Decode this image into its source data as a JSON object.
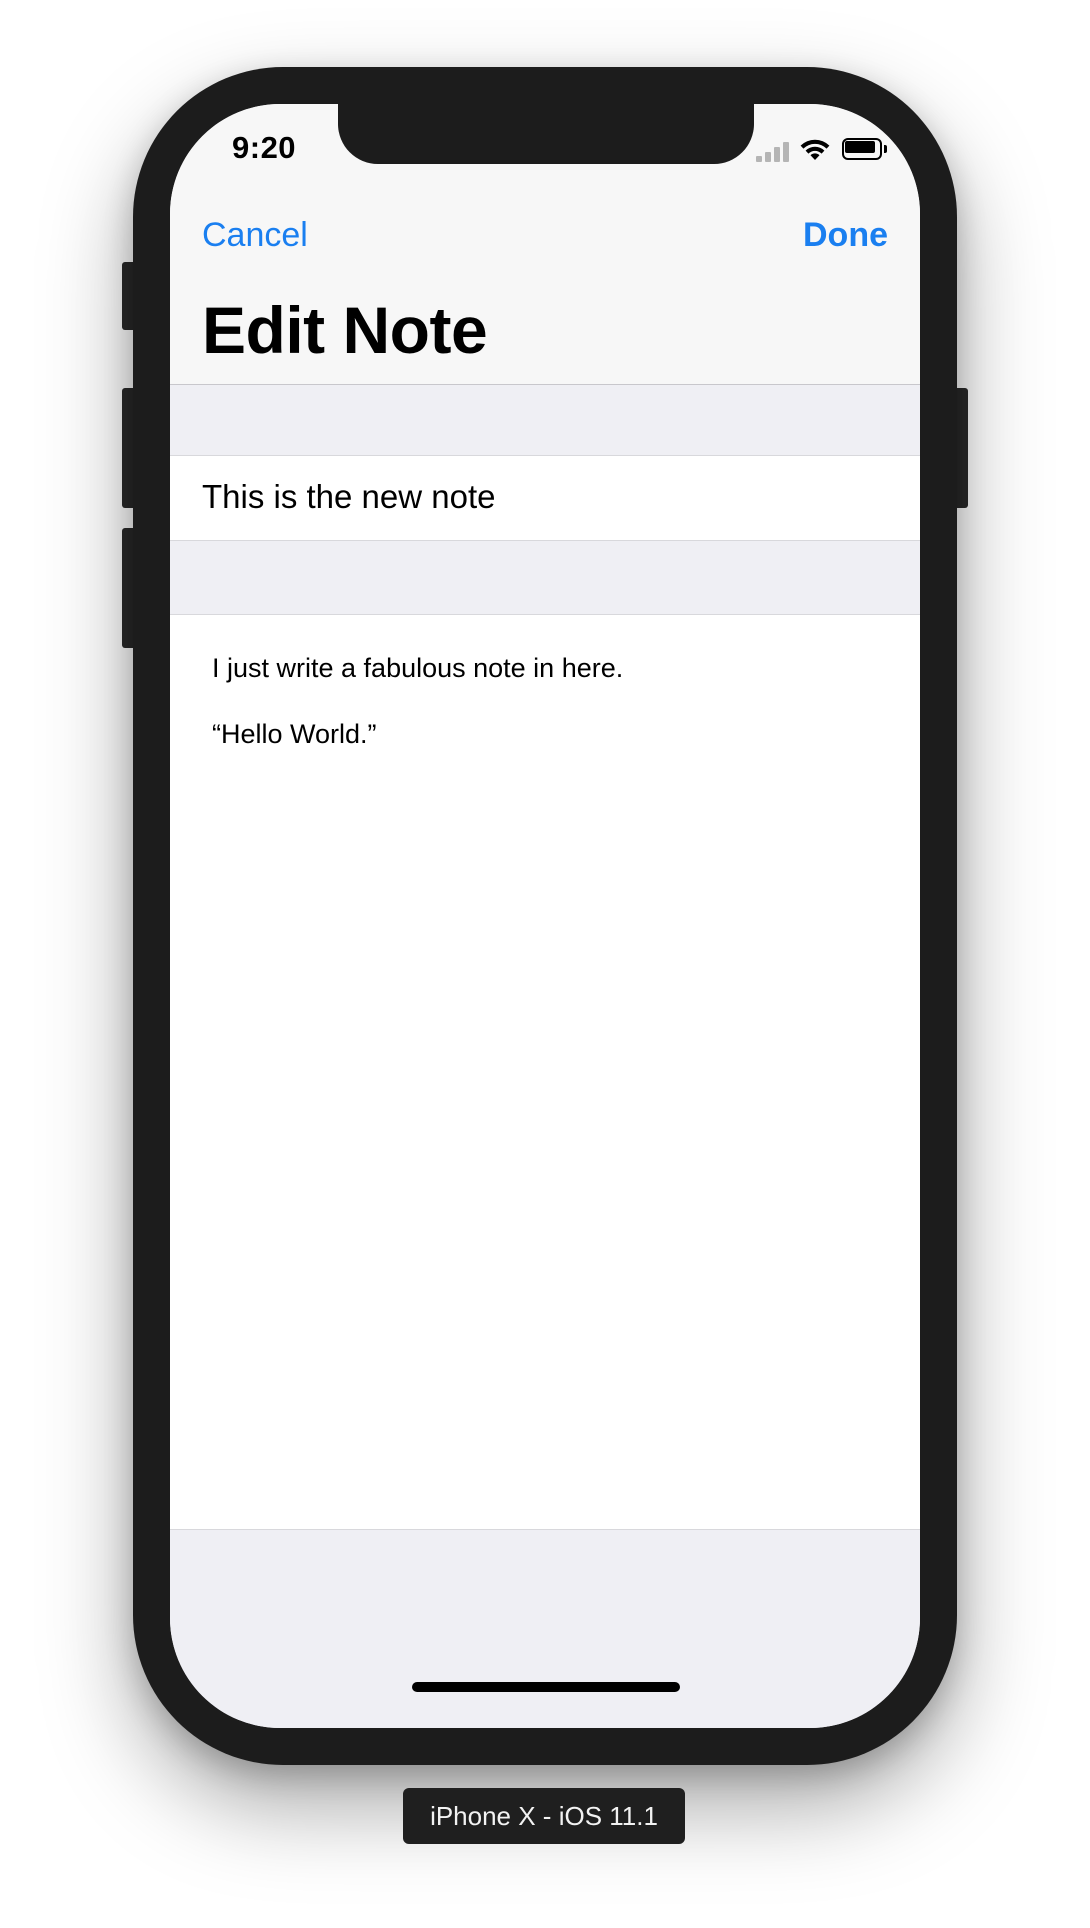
{
  "status_bar": {
    "time": "9:20",
    "icons": [
      "cellular-signal-icon",
      "wifi-icon",
      "battery-icon"
    ]
  },
  "nav": {
    "cancel_label": "Cancel",
    "done_label": "Done",
    "title": "Edit Note"
  },
  "note": {
    "title_value": "This is the new note",
    "body_lines": [
      "I just write a fabulous note in here.",
      "“Hello World.”"
    ]
  },
  "device_label": "iPhone X - iOS 11.1",
  "colors": {
    "accent": "#1a7ff0",
    "grouped_background": "#efeff4",
    "bezel": "#1c1c1c"
  }
}
